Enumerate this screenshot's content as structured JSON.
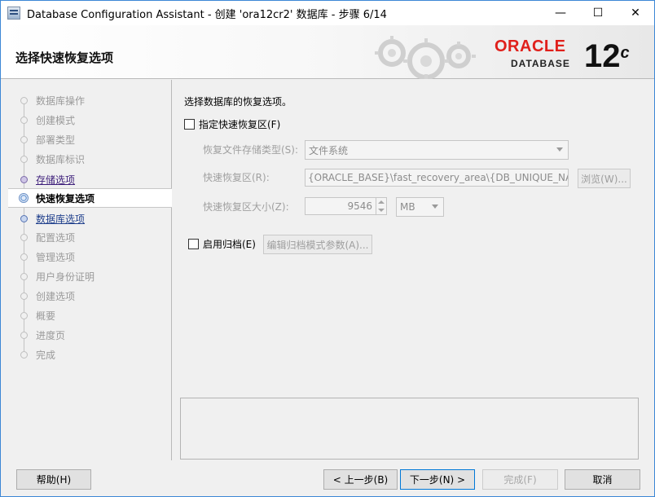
{
  "window": {
    "title": "Database Configuration Assistant - 创建 'ora12cr2' 数据库 - 步骤 6/14",
    "minimize": "—",
    "maximize": "☐",
    "close": "✕"
  },
  "banner": {
    "title": "选择快速恢复选项",
    "brand": "ORACLE",
    "brand_sub": "DATABASE",
    "version": "12",
    "version_suffix": "c"
  },
  "nav": {
    "items": [
      {
        "label": "数据库操作",
        "state": "inactive"
      },
      {
        "label": "创建模式",
        "state": "inactive"
      },
      {
        "label": "部署类型",
        "state": "inactive"
      },
      {
        "label": "数据库标识",
        "state": "inactive"
      },
      {
        "label": "存储选项",
        "state": "done"
      },
      {
        "label": "快速恢复选项",
        "state": "current"
      },
      {
        "label": "数据库选项",
        "state": "next"
      },
      {
        "label": "配置选项",
        "state": "inactive"
      },
      {
        "label": "管理选项",
        "state": "inactive"
      },
      {
        "label": "用户身份证明",
        "state": "inactive"
      },
      {
        "label": "创建选项",
        "state": "inactive"
      },
      {
        "label": "概要",
        "state": "inactive"
      },
      {
        "label": "进度页",
        "state": "inactive"
      },
      {
        "label": "完成",
        "state": "inactive"
      }
    ]
  },
  "main": {
    "intro": "选择数据库的恢复选项。",
    "fra_checkbox": {
      "label": "指定快速恢复区(F)",
      "checked": false
    },
    "storage_type": {
      "label": "恢复文件存储类型(S):",
      "value": "文件系统"
    },
    "fra_location": {
      "label": "快速恢复区(R):",
      "value": "{ORACLE_BASE}\\fast_recovery_area\\{DB_UNIQUE_NAME}",
      "browse": "浏览(W)..."
    },
    "fra_size": {
      "label": "快速恢复区大小(Z):",
      "value": "9546",
      "unit": "MB"
    },
    "archive_checkbox": {
      "label": "启用归档(E)",
      "checked": false
    },
    "archive_params_button": "编辑归档模式参数(A)..."
  },
  "footer": {
    "help": "帮助(H)",
    "back": "< 上一步(B)",
    "next": "下一步(N) >",
    "finish": "完成(F)",
    "cancel": "取消"
  }
}
